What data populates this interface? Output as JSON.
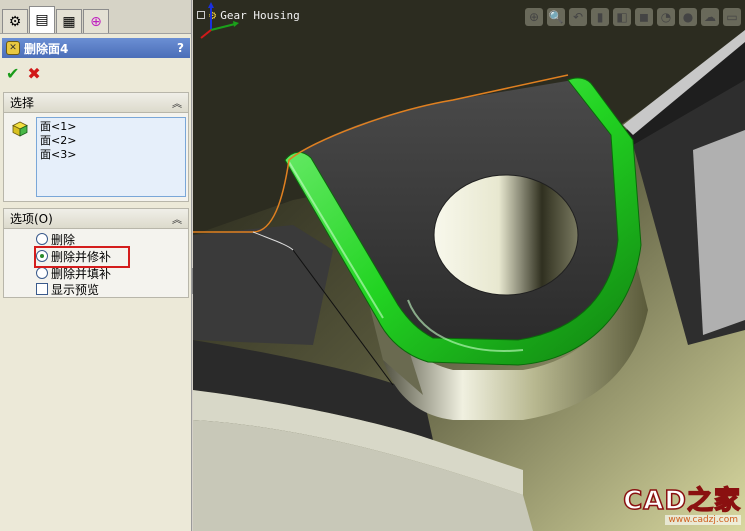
{
  "panel": {
    "tabs": [
      {
        "name": "feature-manager-tab",
        "glyph": "⚙"
      },
      {
        "name": "property-manager-tab",
        "glyph": "▤"
      },
      {
        "name": "configuration-manager-tab",
        "glyph": "▦"
      },
      {
        "name": "dimxpert-manager-tab",
        "glyph": "⊕"
      }
    ],
    "feature_title": "删除面4",
    "help_label": "?",
    "ok_glyph": "✔",
    "cancel_glyph": "✖"
  },
  "selection": {
    "title": "选择",
    "collapse_glyph": "︽",
    "faces": [
      "面<1>",
      "面<2>",
      "面<3>"
    ]
  },
  "options": {
    "title": "选项(O)",
    "collapse_glyph": "︽",
    "delete_label": "删除",
    "delete_patch_label": "删除并修补",
    "delete_fill_label": "删除并填补",
    "preview_label": "显示预览",
    "selected": "delete_patch"
  },
  "splitter_glyph": "◂◂",
  "viewport": {
    "document_title": "Gear Housing",
    "accent_green": "#22d422",
    "edge_orange": "#e08020",
    "toolbar": [
      {
        "name": "zoom-to-fit-icon",
        "glyph": "⊕"
      },
      {
        "name": "zoom-area-icon",
        "glyph": "🔍"
      },
      {
        "name": "previous-view-icon",
        "glyph": "↶"
      },
      {
        "name": "section-view-icon",
        "glyph": "▮"
      },
      {
        "name": "view-orientation-icon",
        "glyph": "◧"
      },
      {
        "name": "display-style-icon",
        "glyph": "◼"
      },
      {
        "name": "hide-show-items-icon",
        "glyph": "◔"
      },
      {
        "name": "edit-appearance-icon",
        "glyph": "●"
      },
      {
        "name": "apply-scene-icon",
        "glyph": "☁"
      },
      {
        "name": "view-settings-icon",
        "glyph": "▭"
      }
    ]
  },
  "watermark": {
    "main": "CAD之家",
    "sub": "www.cadzj.com"
  }
}
